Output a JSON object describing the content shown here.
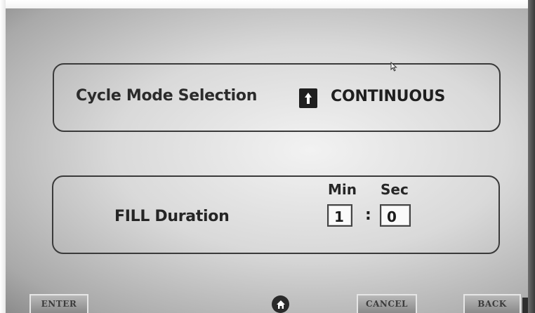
{
  "cycle_mode": {
    "label": "Cycle Mode Selection",
    "arrow_icon": "up-arrow-icon",
    "value": "CONTINUOUS"
  },
  "fill_duration": {
    "label": "FILL Duration",
    "min_header": "Min",
    "sec_header": "Sec",
    "min_value": "1",
    "separator": ":",
    "sec_value": "0"
  },
  "buttons": {
    "enter": "ENTER",
    "home_icon": "home-icon",
    "cancel": "CANCEL",
    "back": "BACK"
  },
  "colors": {
    "text": "#2b2b2b",
    "panel_border": "#3a3a3a",
    "field_background": "#fafafa"
  }
}
